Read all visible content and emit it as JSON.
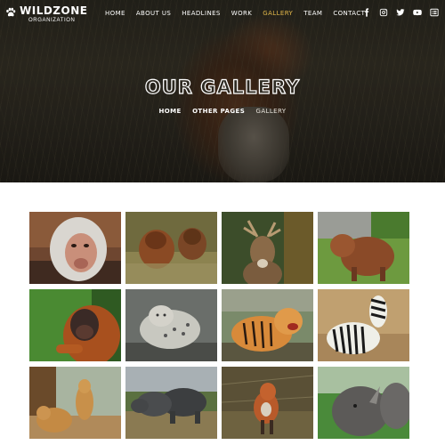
{
  "brand": {
    "name": "WILDZONE",
    "tagline": "ORGANIZATION",
    "icon": "paw-icon"
  },
  "nav": {
    "items": [
      "HOME",
      "ABOUT US",
      "HEADLINES",
      "WORK",
      "GALLERY",
      "TEAM",
      "CONTACT"
    ],
    "active": "GALLERY",
    "active_color": "#e4b84a"
  },
  "social": [
    "facebook-icon",
    "instagram-icon",
    "twitter-icon",
    "youtube-icon",
    "list-icon"
  ],
  "hero": {
    "title": "OUR GALLERY",
    "breadcrumb": [
      "HOME",
      "OTHER PAGES",
      "GALLERY"
    ]
  },
  "gallery": {
    "images": [
      "baboon",
      "bears-in-water",
      "stag",
      "highland-calf",
      "orangutan",
      "snow-leopard",
      "tiger",
      "zebra",
      "lions",
      "rhinos",
      "fox",
      "rhino-closeup"
    ]
  }
}
